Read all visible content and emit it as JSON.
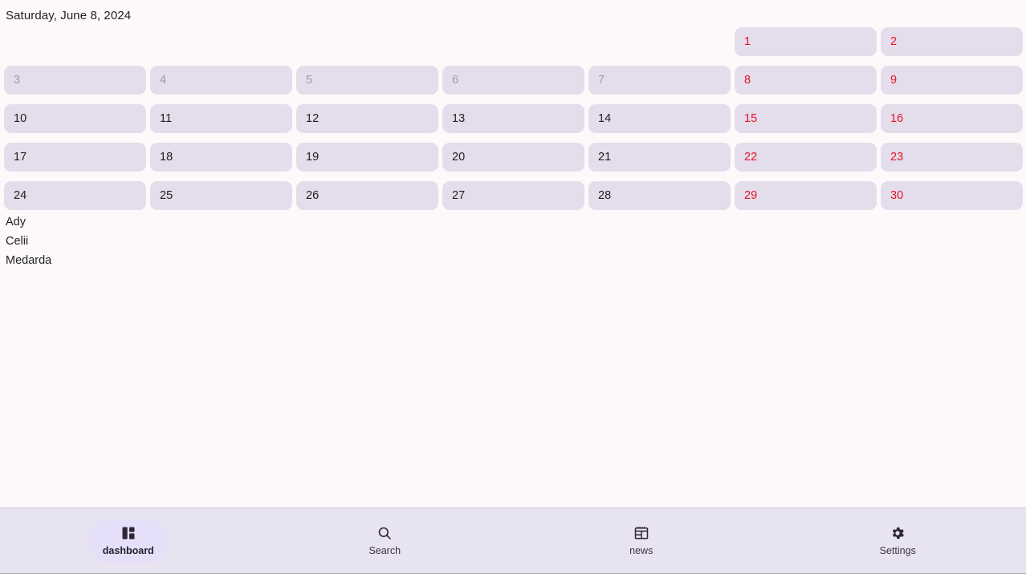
{
  "header": {
    "current_date_label": "Saturday, June 8, 2024"
  },
  "calendar": {
    "month": "June",
    "year": "2024",
    "weeks": [
      [
        {
          "day": "",
          "state": "empty"
        },
        {
          "day": "",
          "state": "empty"
        },
        {
          "day": "",
          "state": "empty"
        },
        {
          "day": "",
          "state": "empty"
        },
        {
          "day": "",
          "state": "empty"
        },
        {
          "day": "1",
          "state": "weekend"
        },
        {
          "day": "2",
          "state": "weekend"
        }
      ],
      [
        {
          "day": "3",
          "state": "past"
        },
        {
          "day": "4",
          "state": "past"
        },
        {
          "day": "5",
          "state": "past"
        },
        {
          "day": "6",
          "state": "past"
        },
        {
          "day": "7",
          "state": "past"
        },
        {
          "day": "8",
          "state": "weekend"
        },
        {
          "day": "9",
          "state": "weekend"
        }
      ],
      [
        {
          "day": "10",
          "state": "normal"
        },
        {
          "day": "11",
          "state": "normal"
        },
        {
          "day": "12",
          "state": "normal"
        },
        {
          "day": "13",
          "state": "normal"
        },
        {
          "day": "14",
          "state": "normal"
        },
        {
          "day": "15",
          "state": "weekend"
        },
        {
          "day": "16",
          "state": "weekend"
        }
      ],
      [
        {
          "day": "17",
          "state": "normal"
        },
        {
          "day": "18",
          "state": "normal"
        },
        {
          "day": "19",
          "state": "normal"
        },
        {
          "day": "20",
          "state": "normal"
        },
        {
          "day": "21",
          "state": "normal"
        },
        {
          "day": "22",
          "state": "weekend"
        },
        {
          "day": "23",
          "state": "weekend"
        }
      ],
      [
        {
          "day": "24",
          "state": "normal"
        },
        {
          "day": "25",
          "state": "normal"
        },
        {
          "day": "26",
          "state": "normal"
        },
        {
          "day": "27",
          "state": "normal"
        },
        {
          "day": "28",
          "state": "normal"
        },
        {
          "day": "29",
          "state": "weekend"
        },
        {
          "day": "30",
          "state": "weekend"
        }
      ]
    ]
  },
  "names_list": [
    {
      "name": "Ady"
    },
    {
      "name": "Celii"
    },
    {
      "name": "Medarda"
    }
  ],
  "bottom_nav": {
    "items": [
      {
        "label": "dashboard",
        "icon": "dashboard-icon",
        "active": true
      },
      {
        "label": "Search",
        "icon": "search-icon",
        "active": false
      },
      {
        "label": "news",
        "icon": "news-icon",
        "active": false
      },
      {
        "label": "Settings",
        "icon": "gear-icon",
        "active": false
      }
    ]
  },
  "colors": {
    "page_background": "#fdf9fb",
    "cell_background": "#e4ddeb",
    "weekend_text": "#e8122a",
    "past_text": "#9e9aa5",
    "normal_text": "#1f1f21",
    "nav_background": "#e8e3f0",
    "nav_active_pill": "#e5dffa"
  }
}
